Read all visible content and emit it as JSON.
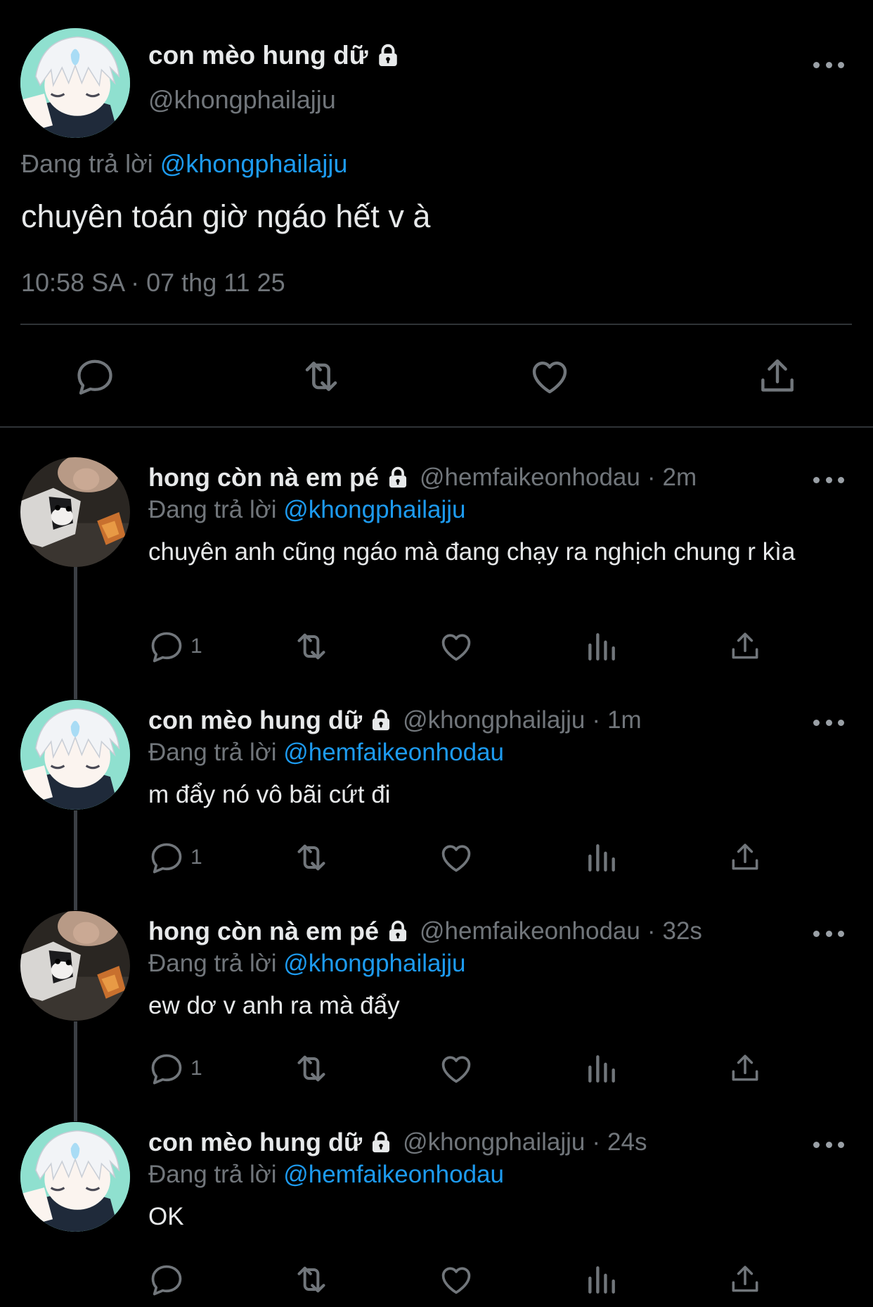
{
  "main_tweet": {
    "display_name": "con mèo hung dữ",
    "handle": "@khongphailajju",
    "replying_prefix": "Đang trả lời",
    "replying_to": "@khongphailajju",
    "text": "chuyên toán giờ ngáo hết v à",
    "timestamp": "10:58 SA · 07 thg 11 25",
    "avatar_icon": "anime-avatar-white-hair",
    "actions": [
      "reply-icon",
      "retweet-icon",
      "like-icon",
      "share-icon"
    ]
  },
  "replies": [
    {
      "display_name": "hong còn nà em pé",
      "handle": "@hemfaikeonhodau",
      "separator": "·",
      "age": "2m",
      "replying_prefix": "Đang trả lời",
      "replying_to": "@khongphailajju",
      "text": "chuyên anh cũng ngáo mà đang chạy ra nghịch chung r kìa",
      "reply_count": "1",
      "avatar_icon": "dog-photo-avatar"
    },
    {
      "display_name": "con mèo hung dữ",
      "handle": "@khongphailajju",
      "separator": "·",
      "age": "1m",
      "replying_prefix": "Đang trả lời",
      "replying_to": "@hemfaikeonhodau",
      "text": "m đẩy nó vô bãi cứt đi",
      "reply_count": "1",
      "avatar_icon": "anime-avatar-white-hair"
    },
    {
      "display_name": "hong còn nà em pé",
      "handle": "@hemfaikeonhodau",
      "separator": "·",
      "age": "32s",
      "replying_prefix": "Đang trả lời",
      "replying_to": "@khongphailajju",
      "text": "ew dơ v anh ra mà đẩy",
      "reply_count": "1",
      "avatar_icon": "dog-photo-avatar"
    },
    {
      "display_name": "con mèo hung dữ",
      "handle": "@khongphailajju",
      "separator": "·",
      "age": "24s",
      "replying_prefix": "Đang trả lời",
      "replying_to": "@hemfaikeonhodau",
      "text": "OK",
      "reply_count": "",
      "avatar_icon": "anime-avatar-white-hair"
    }
  ],
  "colors": {
    "background": "#000000",
    "text": "#e7e9ea",
    "secondary": "#71767b",
    "link": "#1d9bf0",
    "divider": "#2f3336"
  }
}
